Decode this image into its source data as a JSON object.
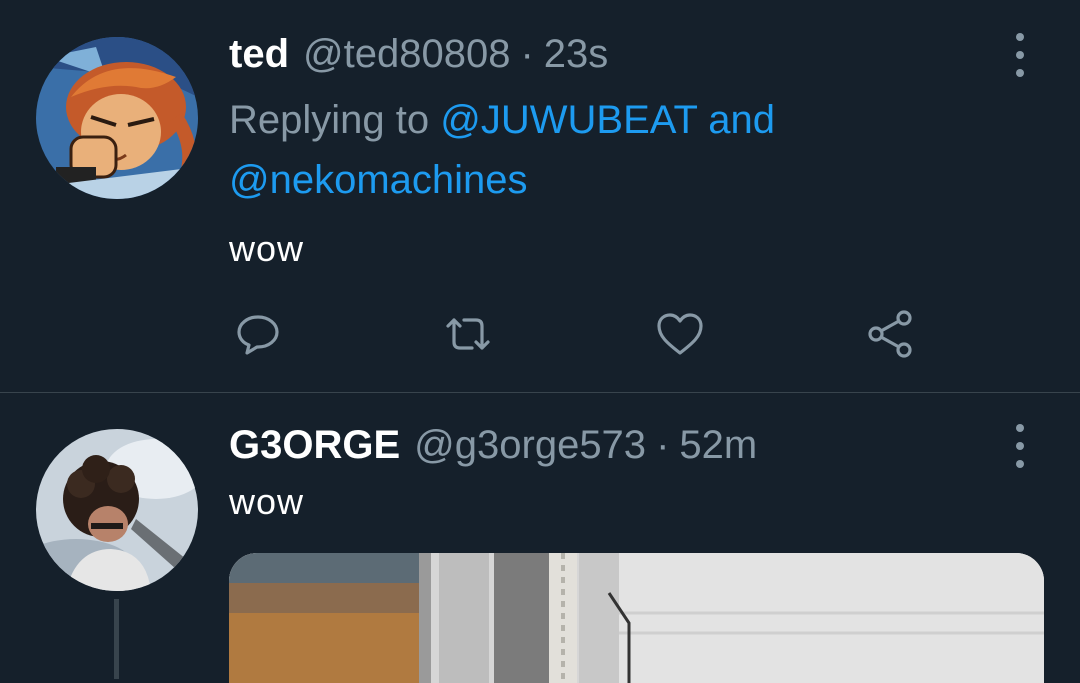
{
  "tweets": [
    {
      "name": "ted",
      "handle": "@ted80808",
      "separator": "·",
      "time": "23s",
      "replying_prefix": "Replying to",
      "mention1": "@JUWUBEAT",
      "and": "and",
      "mention2": "@nekomachines",
      "text": "wow",
      "actions": [
        "reply-icon",
        "retweet-icon",
        "like-icon",
        "share-icon"
      ]
    },
    {
      "name": "G3ORGE",
      "handle": "@g3orge573",
      "separator": "·",
      "time": "52m",
      "text": "wow"
    }
  ],
  "colors": {
    "background": "#15202b",
    "divider": "#38444d",
    "secondary_text": "#8899a6",
    "link": "#1d9bf0"
  }
}
